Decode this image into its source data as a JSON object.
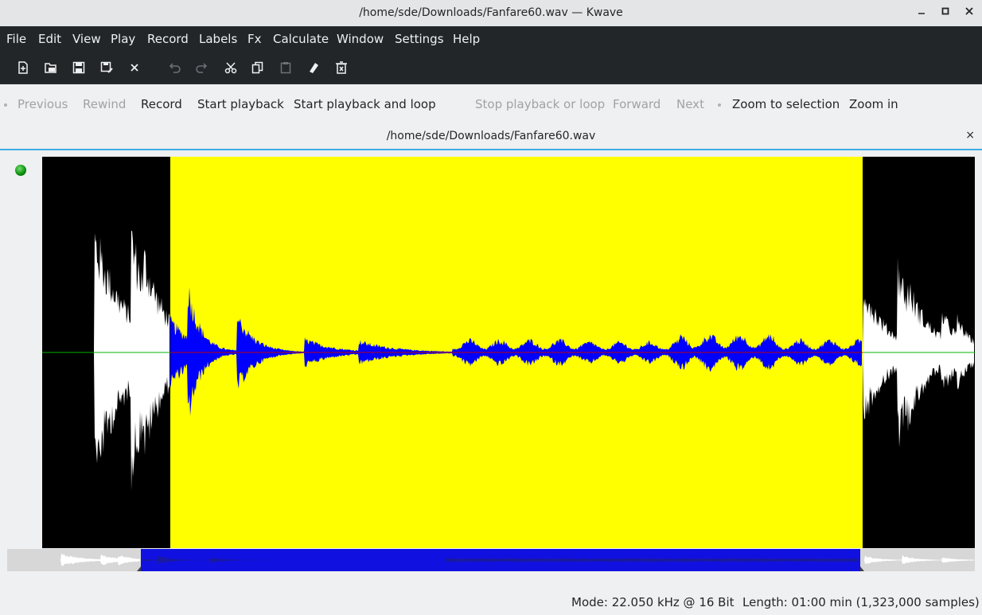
{
  "window": {
    "title": "/home/sde/Downloads/Fanfare60.wav — Kwave",
    "buttons": [
      "minimize",
      "maximize",
      "close"
    ]
  },
  "menu": {
    "items": [
      "File",
      "Edit",
      "View",
      "Play",
      "Record",
      "Labels",
      "Fx",
      "Calculate",
      "Window",
      "Settings",
      "Help"
    ]
  },
  "toolbar": {
    "icons": [
      "new-file-icon",
      "open-file-icon",
      "save-icon",
      "save-as-icon",
      "close-file-icon",
      "undo-icon",
      "redo-icon",
      "cut-icon",
      "copy-icon",
      "paste-icon",
      "erase-icon",
      "delete-icon"
    ]
  },
  "transport": {
    "previous": "Previous",
    "rewind": "Rewind",
    "record": "Record",
    "start_playback": "Start playback",
    "start_playback_loop": "Start playback and loop",
    "stop": "Stop playback or loop",
    "forward": "Forward",
    "next": "Next",
    "zoom_selection": "Zoom to selection",
    "zoom_in": "Zoom in"
  },
  "tab": {
    "title": "/home/sde/Downloads/Fanfare60.wav",
    "close": "×"
  },
  "colors": {
    "selection": "#ffff00",
    "waveform_selected": "#0000ff",
    "waveform": "#ffffff",
    "background": "#000000",
    "zero_line": "#00b400",
    "accent": "#3daee9"
  },
  "status": {
    "mode": "Mode: 22.050 kHz @ 16 Bit",
    "length": "Length: 01:00 min (1,323,000 samples)"
  }
}
